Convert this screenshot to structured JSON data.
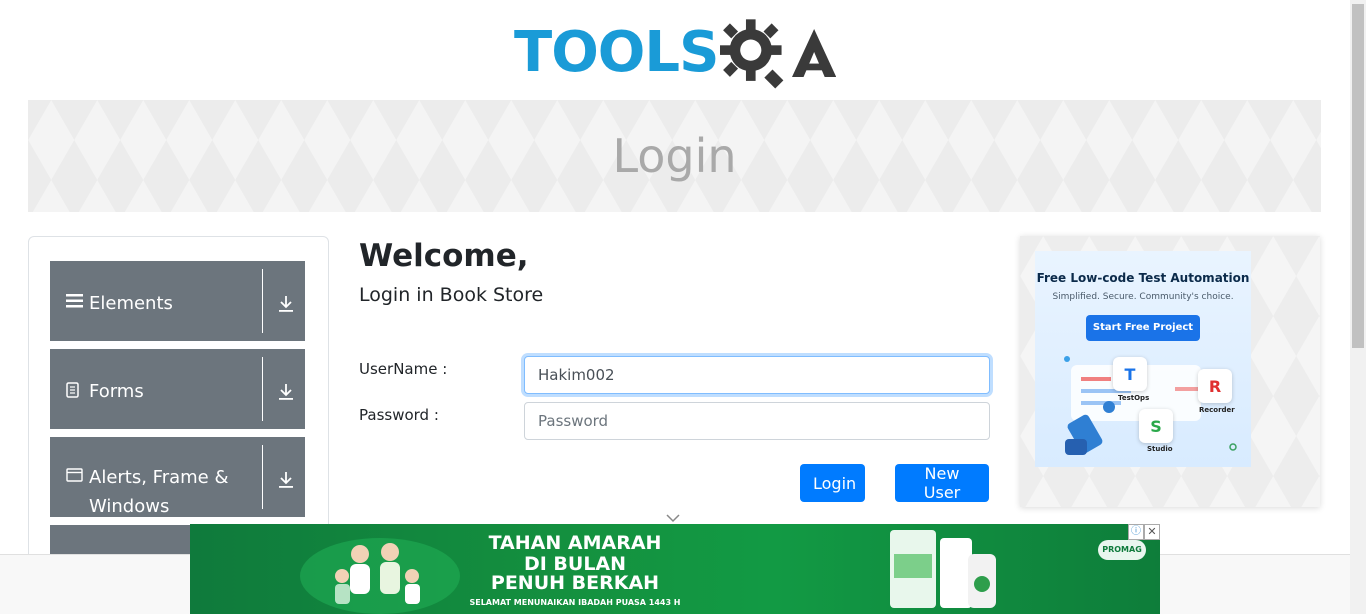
{
  "header": {
    "logo_tools": "TOOLS",
    "logo_qa": "QA",
    "logo_icon": "gear-icon"
  },
  "banner": {
    "title": "Login"
  },
  "sidebar": {
    "groups": [
      {
        "label": "Elements",
        "icon": "hamburger-icon"
      },
      {
        "label": "Forms",
        "icon": "document-icon"
      },
      {
        "label": "Alerts, Frame & Windows",
        "icon": "window-icon"
      }
    ]
  },
  "main": {
    "welcome": "Welcome,",
    "subtitle": "Login in Book Store",
    "username_label": "UserName :",
    "password_label": "Password :",
    "username_value": "Hakim002",
    "password_placeholder": "Password",
    "login_button": "Login",
    "new_user_button": "New User"
  },
  "side_ad": {
    "title": "Free Low-code Test Automation",
    "subtitle": "Simplified. Secure. Community's choice.",
    "button": "Start Free Project",
    "tools": [
      "TestOps",
      "Recorder",
      "Studio"
    ]
  },
  "bottom_ad": {
    "line1": "TAHAN AMARAH",
    "line2": "DI BULAN",
    "line3": "PENUH BERKAH",
    "line4": "SELAMAT MENUNAIKAN IBADAH PUASA 1443 H",
    "brand": "PROMAG",
    "close": "✕",
    "info": "ⓘ"
  },
  "colors": {
    "primary": "#007bff",
    "sidebar_group": "#6c757d",
    "logo_blue": "#1a9bd7",
    "logo_dark": "#3a3a3a"
  }
}
